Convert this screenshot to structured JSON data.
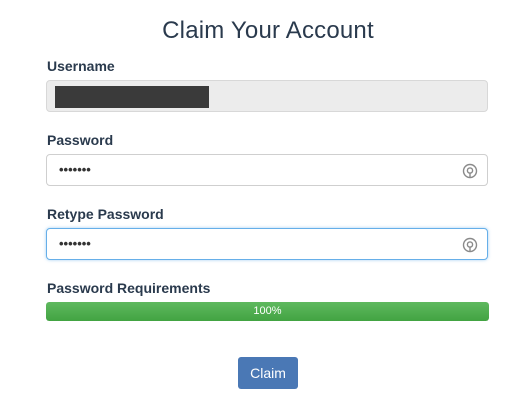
{
  "form": {
    "title": "Claim Your Account",
    "username_label": "Username",
    "password_label": "Password",
    "password_mask": "•••••••",
    "retype_label": "Retype Password",
    "retype_mask": "•••••••",
    "requirements_label": "Password Requirements",
    "progress_percent": 100,
    "progress_text": "100%",
    "submit_label": "Claim"
  },
  "icons": {
    "password_toggle": "eye-toggle-icon"
  },
  "colors": {
    "title": "#2a3a4d",
    "progress": "#4cae4c",
    "button": "#4a78b5",
    "focus_border": "#66afe9"
  }
}
